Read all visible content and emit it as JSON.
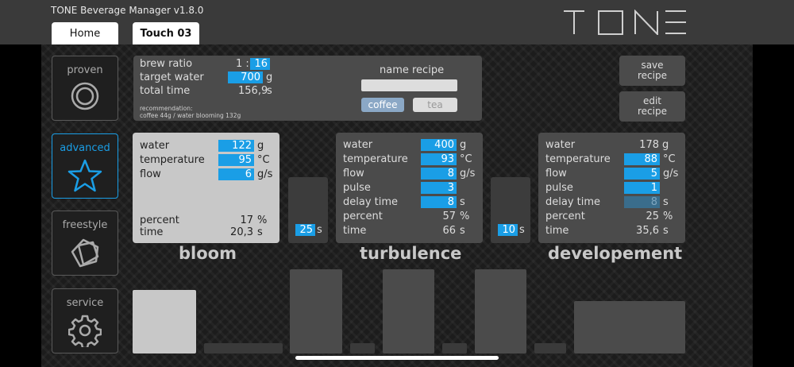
{
  "app": {
    "title": "TONE Beverage Manager v1.8.0",
    "logo_text": "TONE",
    "tabs": [
      {
        "label": "Home"
      },
      {
        "label": "Touch 03"
      }
    ]
  },
  "nav": [
    {
      "label": "proven",
      "icon": "ring-icon"
    },
    {
      "label": "advanced",
      "icon": "star-icon",
      "active": true
    },
    {
      "label": "freestyle",
      "icon": "cube-icon"
    },
    {
      "label": "service",
      "icon": "gear-icon"
    }
  ],
  "recipe": {
    "brew_ratio_label": "brew ratio",
    "brew_ratio_prefix": "1 :",
    "brew_ratio_value": "16",
    "target_water_label": "target water",
    "target_water_value": "700",
    "target_water_unit": "g",
    "total_time_label": "total time",
    "total_time_value": "156,9",
    "total_time_unit": "s",
    "recommendation_line1": "recommendation:",
    "recommendation_line2": "coffee 44g / water blooming 132g",
    "name_recipe_label": "name recipe",
    "name_recipe_value": "",
    "coffee_label": "coffee",
    "tea_label": "tea"
  },
  "actions": {
    "save_line1": "save",
    "save_line2": "recipe",
    "edit_line1": "edit",
    "edit_line2": "recipe"
  },
  "bloom": {
    "name": "bloom",
    "water_label": "water",
    "water_value": "122",
    "water_unit": "g",
    "temp_label": "temperature",
    "temp_value": "95",
    "temp_unit": "°C",
    "flow_label": "flow",
    "flow_value": "6",
    "flow_unit": "g/s",
    "percent_label": "percent",
    "percent_value": "17",
    "percent_unit": "%",
    "time_label": "time",
    "time_value": "20,3",
    "time_unit": "s"
  },
  "delay1": {
    "value": "25",
    "unit": "s"
  },
  "turbulence": {
    "name": "turbulence",
    "water_label": "water",
    "water_value": "400",
    "water_unit": "g",
    "temp_label": "temperature",
    "temp_value": "93",
    "temp_unit": "°C",
    "flow_label": "flow",
    "flow_value": "8",
    "flow_unit": "g/s",
    "pulse_label": "pulse",
    "pulse_value": "3",
    "delay_label": "delay time",
    "delay_value": "8",
    "delay_unit": "s",
    "percent_label": "percent",
    "percent_value": "57",
    "percent_unit": "%",
    "time_label": "time",
    "time_value": "66",
    "time_unit": "s"
  },
  "delay2": {
    "value": "10",
    "unit": "s"
  },
  "development": {
    "name": "developement",
    "water_label": "water",
    "water_value": "178",
    "water_unit": "g",
    "temp_label": "temperature",
    "temp_value": "88",
    "temp_unit": "°C",
    "flow_label": "flow",
    "flow_value": "5",
    "flow_unit": "g/s",
    "pulse_label": "pulse",
    "pulse_value": "1",
    "delay_label": "delay time",
    "delay_value": "8",
    "delay_unit": "s",
    "percent_label": "percent",
    "percent_value": "25",
    "percent_unit": "%",
    "time_label": "time",
    "time_value": "35,6",
    "time_unit": "s"
  },
  "colors": {
    "accent": "#1a9ee6",
    "panel_active": "#c8c8c8",
    "panel_inactive": "#4b4b4b"
  }
}
